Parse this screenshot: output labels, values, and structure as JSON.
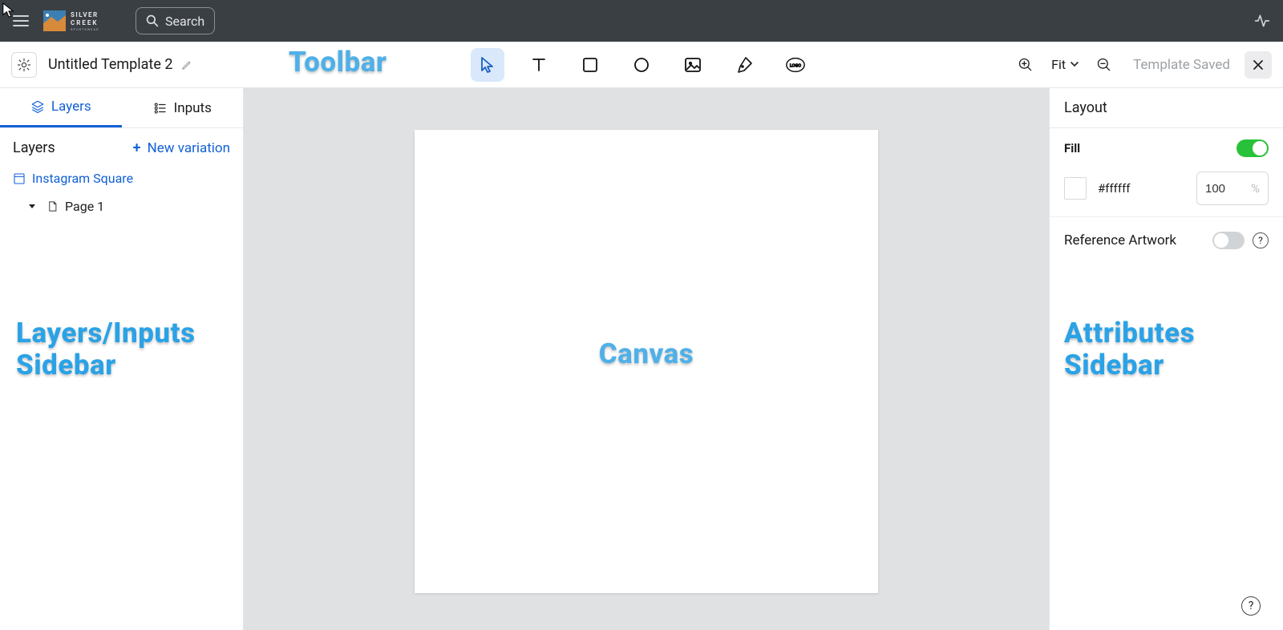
{
  "brand": {
    "name": "SILVER CREEK",
    "tagline": "SPORTSWEAR"
  },
  "header": {
    "search_label": "Search"
  },
  "toolbar": {
    "title": "Untitled Template 2",
    "zoom_label": "Fit",
    "saved_label": "Template Saved",
    "tools": [
      {
        "id": "select",
        "active": true
      },
      {
        "id": "text",
        "active": false
      },
      {
        "id": "rectangle",
        "active": false
      },
      {
        "id": "ellipse",
        "active": false
      },
      {
        "id": "image",
        "active": false
      },
      {
        "id": "pen",
        "active": false
      },
      {
        "id": "logo",
        "active": false
      }
    ]
  },
  "left": {
    "tabs": {
      "layers": "Layers",
      "inputs": "Inputs"
    },
    "layers_header": "Layers",
    "new_variation": "New variation",
    "items": {
      "variation_name": "Instagram Square",
      "page_name": "Page 1"
    }
  },
  "right": {
    "header": "Layout",
    "fill_label": "Fill",
    "fill_on": true,
    "fill_hex": "#ffffff",
    "fill_opacity": "100",
    "fill_opacity_unit": "%",
    "reference_label": "Reference Artwork",
    "reference_on": false
  },
  "annotations": {
    "toolbar": "Toolbar",
    "canvas": "Canvas",
    "left_l1": "Layers/Inputs",
    "left_l2": "Sidebar",
    "right_l1": "Attributes",
    "right_l2": "Sidebar"
  }
}
